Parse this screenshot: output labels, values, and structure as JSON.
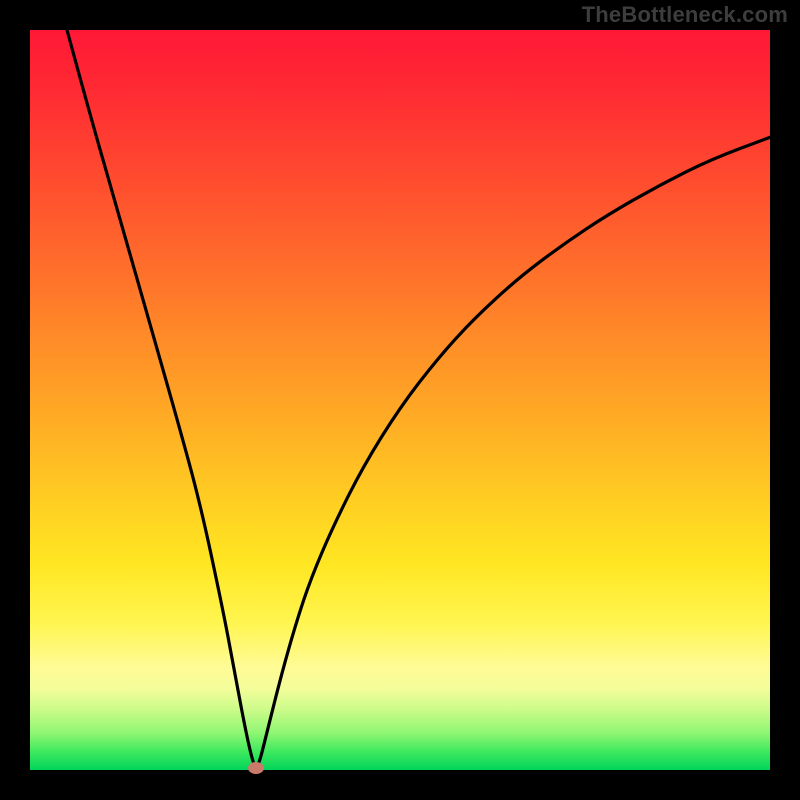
{
  "watermark": "TheBottleneck.com",
  "chart_data": {
    "type": "line",
    "title": "",
    "xlabel": "",
    "ylabel": "",
    "xlim": [
      0,
      100
    ],
    "ylim": [
      0,
      100
    ],
    "grid": false,
    "legend": false,
    "background": "rainbow-gradient",
    "series": [
      {
        "name": "bottleneck-curve",
        "color": "#000000",
        "x": [
          5,
          8,
          11,
          14,
          17,
          20,
          23,
          26,
          27.5,
          29,
          30,
          30.5,
          31,
          32,
          34,
          36,
          38,
          41,
          45,
          50,
          55,
          60,
          66,
          72,
          78,
          85,
          92,
          100
        ],
        "y": [
          100,
          89,
          78.5,
          68,
          57.5,
          47,
          36,
          22,
          14,
          6,
          1.5,
          0.3,
          1,
          5,
          13,
          20,
          26,
          33,
          41,
          49,
          55.5,
          61,
          66.5,
          71,
          75,
          79,
          82.5,
          85.5
        ]
      }
    ],
    "marker": {
      "x": 30.5,
      "y": 0.3,
      "color": "#c97a6a"
    }
  }
}
